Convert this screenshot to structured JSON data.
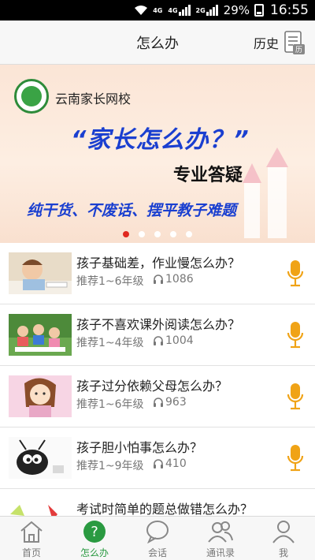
{
  "status_bar": {
    "net1": "4G",
    "net2": "4G",
    "net3": "2G",
    "battery": "29%",
    "time": "16:55"
  },
  "header": {
    "title": "怎么办",
    "history_label": "历史",
    "history_icon": "history-calendar-icon"
  },
  "banner": {
    "school_name": "云南家长网校",
    "headline": "“家长怎么办？”",
    "subheadline": "专业答疑",
    "tagline": "纯干货、不废话、摆平教子难题",
    "slide_count": 5,
    "active_slide": 0
  },
  "items": [
    {
      "title": "孩子基础差，作业慢怎么办？",
      "grade": "推荐1~6年级",
      "listens": "1086",
      "thumb": "child-writing-thumb"
    },
    {
      "title": "孩子不喜欢课外阅读怎么办？",
      "grade": "推荐1~4年级",
      "listens": "1004",
      "thumb": "children-reading-thumb"
    },
    {
      "title": "孩子过分依赖父母怎么办？",
      "grade": "推荐1~6年级",
      "listens": "963",
      "thumb": "cartoon-girl-thumb"
    },
    {
      "title": "孩子胆小怕事怎么办？",
      "grade": "推荐1~9年级",
      "listens": "410",
      "thumb": "cartoon-bug-thumb"
    },
    {
      "title": "考试时简单的题总做错怎么办？",
      "grade": "",
      "listens": "",
      "thumb": "exam-thumb"
    }
  ],
  "tabs": [
    {
      "label": "首页",
      "icon": "home-icon"
    },
    {
      "label": "怎么办",
      "icon": "question-icon",
      "active": true
    },
    {
      "label": "会话",
      "icon": "chat-bubble-icon"
    },
    {
      "label": "通讯录",
      "icon": "contacts-icon"
    },
    {
      "label": "我",
      "icon": "profile-icon"
    }
  ],
  "colors": {
    "accent_green": "#2a9a41",
    "mic_orange": "#f0a316",
    "active_dot": "#e0291f",
    "banner_blue": "#1a3fd0"
  }
}
